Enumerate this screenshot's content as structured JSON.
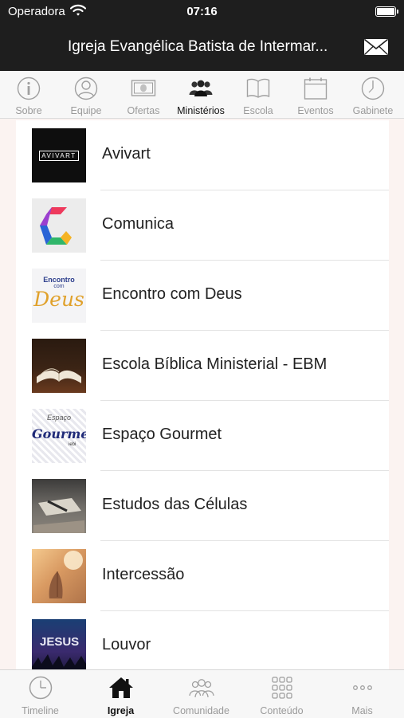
{
  "status_bar": {
    "carrier": "Operadora",
    "time": "07:16"
  },
  "header": {
    "title": "Igreja Evangélica Batista de Intermar...",
    "mail_icon": "envelope-icon"
  },
  "top_tabs": [
    {
      "label": "Sobre",
      "icon": "info-icon"
    },
    {
      "label": "Equipe",
      "icon": "person-icon"
    },
    {
      "label": "Ofertas",
      "icon": "money-icon"
    },
    {
      "label": "Ministérios",
      "icon": "group-icon",
      "active": true
    },
    {
      "label": "Escola",
      "icon": "book-icon"
    },
    {
      "label": "Eventos",
      "icon": "calendar-icon"
    },
    {
      "label": "Gabinete",
      "icon": "clock-icon"
    }
  ],
  "ministries": [
    {
      "name": "Avivart",
      "thumb_text": "AVIVART"
    },
    {
      "name": "Comunica"
    },
    {
      "name": "Encontro com Deus",
      "thumb_text_1": "Encontro",
      "thumb_text_2": "com",
      "thumb_text_3": "Deus"
    },
    {
      "name": "Escola Bíblica Ministerial - EBM"
    },
    {
      "name": "Espaço Gourmet",
      "thumb_text_1": "Espaço",
      "thumb_text_2": "Gourmet",
      "thumb_text_3": "iebi"
    },
    {
      "name": "Estudos das Células"
    },
    {
      "name": "Intercessão"
    },
    {
      "name": "Louvor",
      "thumb_text": "JESUS"
    }
  ],
  "bottom_tabs": [
    {
      "label": "Timeline",
      "icon": "clock-icon"
    },
    {
      "label": "Igreja",
      "icon": "home-icon",
      "active": true
    },
    {
      "label": "Comunidade",
      "icon": "people-icon"
    },
    {
      "label": "Conteúdo",
      "icon": "grid-icon"
    },
    {
      "label": "Mais",
      "icon": "more-icon"
    }
  ],
  "colors": {
    "bar": "#1e1e1e",
    "background": "#fbf3f1",
    "inactive": "#9a9a9a",
    "active": "#111111"
  }
}
